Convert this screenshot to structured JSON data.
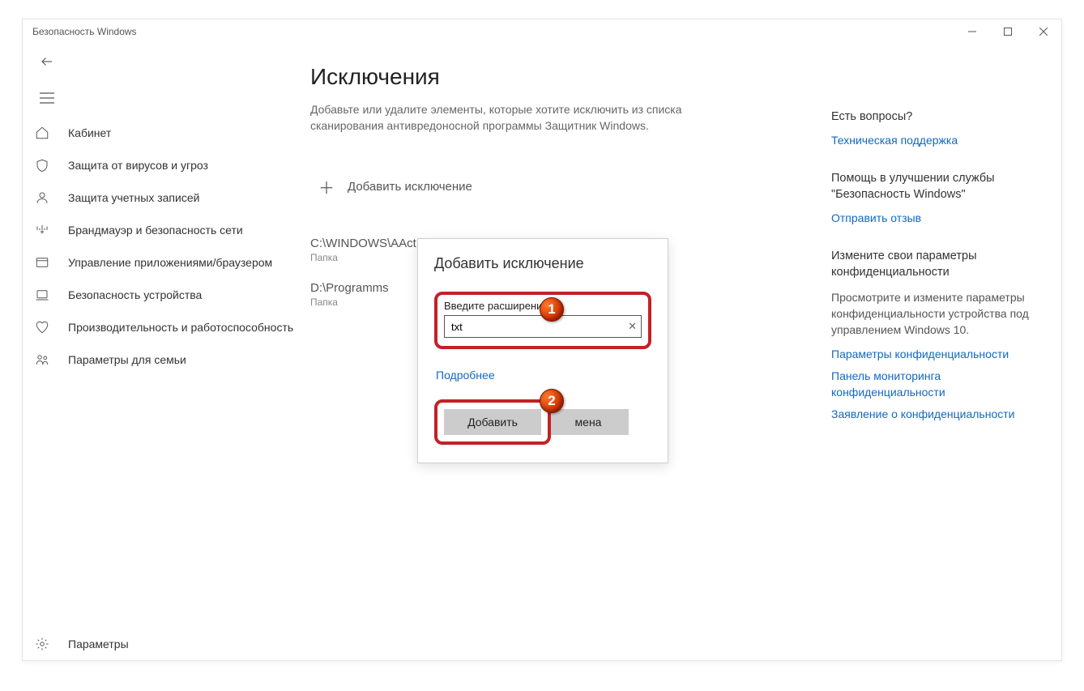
{
  "window": {
    "title": "Безопасность Windows"
  },
  "sidebar": {
    "items": [
      {
        "label": "Кабинет"
      },
      {
        "label": "Защита от вирусов и угроз"
      },
      {
        "label": "Защита учетных записей"
      },
      {
        "label": "Брандмауэр и безопасность сети"
      },
      {
        "label": "Управление приложениями/браузером"
      },
      {
        "label": "Безопасность устройства"
      },
      {
        "label": "Производительность и работоспособность"
      },
      {
        "label": "Параметры для семьи"
      }
    ],
    "settings_label": "Параметры"
  },
  "main": {
    "title": "Исключения",
    "description": "Добавьте или удалите элементы, которые хотите исключить из списка сканирования антивредоносной программы Защитник Windows.",
    "add_exclusion_label": "Добавить исключение",
    "exclusions": [
      {
        "path": "C:\\WINDOWS\\AAct",
        "type": "Папка"
      },
      {
        "path": "D:\\Programms",
        "type": "Папка"
      }
    ]
  },
  "dialog": {
    "title": "Добавить исключение",
    "field_label": "Введите расширение",
    "field_value": "txt",
    "more_link": "Подробнее",
    "add_button": "Добавить",
    "cancel_button": "мена"
  },
  "right": {
    "q_title": "Есть вопросы?",
    "q_link": "Техническая поддержка",
    "help_title": "Помощь в улучшении службы \"Безопасность Windows\"",
    "help_link": "Отправить отзыв",
    "priv_title": "Измените свои параметры конфиденциальности",
    "priv_text": "Просмотрите и измените параметры конфиденциальности устройства под управлением Windows 10.",
    "priv_link1": "Параметры конфиденциальности",
    "priv_link2": "Панель мониторинга конфиденциальности",
    "priv_link3": "Заявление о конфиденциальности"
  },
  "badges": {
    "one": "1",
    "two": "2"
  }
}
